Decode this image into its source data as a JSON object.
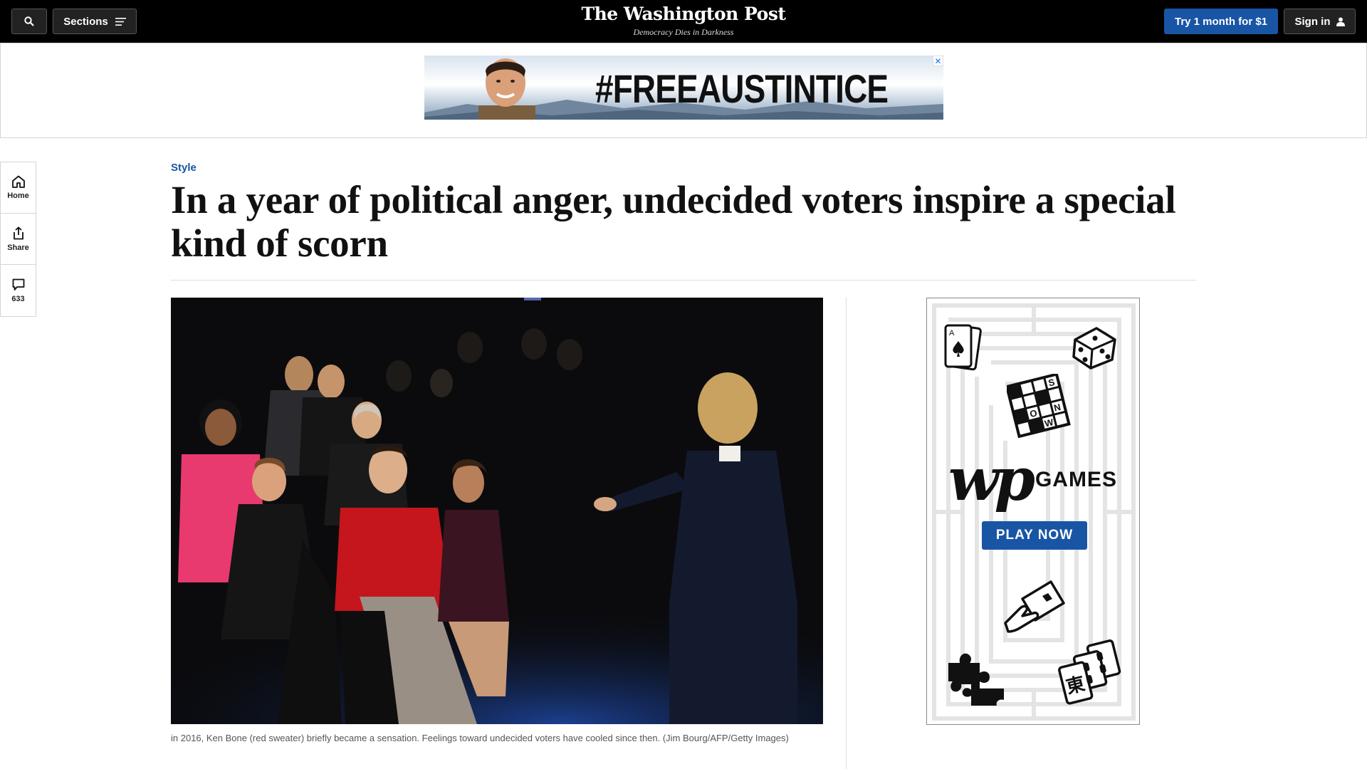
{
  "topbar": {
    "search_icon": "search-icon",
    "sections_label": "Sections",
    "logo": "The Washington Post",
    "tagline": "Democracy Dies in Darkness",
    "try_label": "Try 1 month for $1",
    "signin_label": "Sign in"
  },
  "ad": {
    "hashtag": "#FREEAUSTINTICE",
    "close_label": "✕"
  },
  "leftrail": {
    "home_label": "Home",
    "share_label": "Share",
    "comments_count": "633"
  },
  "article": {
    "kicker": "Style",
    "headline": "In a year of political anger, undecided voters inspire a special kind of scorn",
    "caption": "in 2016, Ken Bone (red sweater) briefly became a sensation. Feelings toward undecided voters have cooled since then. (Jim Bourg/AFP/Getty Images)"
  },
  "games_ad": {
    "wp_mark": "wp",
    "games_label": "GAMES",
    "play_label": "PLAY NOW"
  },
  "colors": {
    "accent_blue": "#1955a5",
    "topbar_bg": "#000000",
    "sweater_red": "#c4161c",
    "jacket_pink": "#e83a6e"
  }
}
